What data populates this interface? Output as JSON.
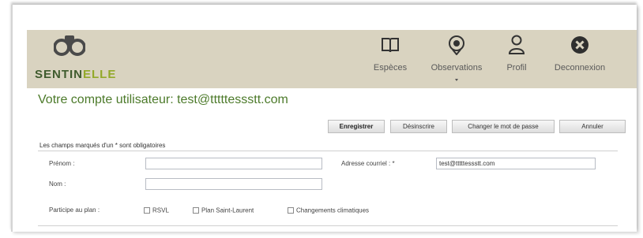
{
  "brand": {
    "part1": "SENTIN",
    "part2": "ELLE"
  },
  "nav": [
    {
      "label": "Espèces",
      "icon": "book-icon"
    },
    {
      "label": "Observations",
      "icon": "location-pin-icon"
    },
    {
      "label": "Profil",
      "icon": "user-icon"
    },
    {
      "label": "Deconnexion",
      "icon": "close-circle-icon"
    }
  ],
  "page_title": "Votre compte utilisateur: test@tttttessstt.com",
  "buttons": {
    "save": "Enregistrer",
    "unsubscribe": "Désinscrire",
    "change_password": "Changer le mot de passe",
    "cancel": "Annuler"
  },
  "required_note": "Les champs marqués d'un * sont obligatoires",
  "form": {
    "first_name_label": "Prénom :",
    "first_name_value": "",
    "last_name_label": "Nom :",
    "last_name_value": "",
    "email_label": "Adresse courriel : *",
    "email_value": "test@tttttessstt.com",
    "plan_label": "Participe au plan :",
    "plans": [
      "RSVL",
      "Plan Saint-Laurent",
      "Changements climatiques"
    ]
  },
  "colors": {
    "header_bg": "#d9d3c0",
    "title_green": "#4c7a2a",
    "brand_dark": "#3f5b2d",
    "brand_light": "#93a92a"
  }
}
